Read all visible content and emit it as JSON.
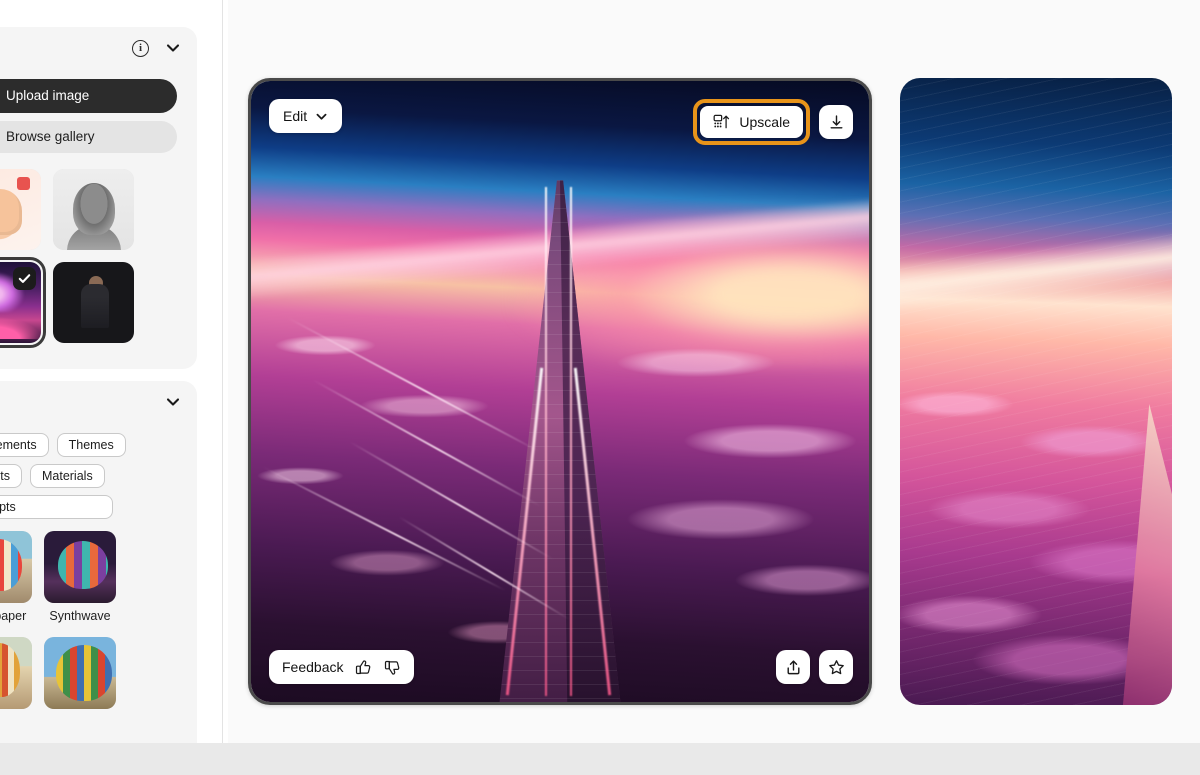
{
  "app": {
    "background_color": "#e9e9e9",
    "canvas_color": "#fafafa",
    "accent_highlight_color": "#e8941a"
  },
  "sidebar": {
    "upload_panel": {
      "info_icon": "info-circle-icon",
      "collapse_icon": "chevron-down-icon",
      "upload_button": {
        "label": "Upload image",
        "icon": "upload-cloud-icon"
      },
      "browse_button": {
        "label": "Browse gallery",
        "icon": "binoculars-icon"
      },
      "reference_thumbnails": [
        {
          "name": "thumbs-up-illustration",
          "selected": false
        },
        {
          "name": "classical-portrait-sketch",
          "selected": false
        },
        {
          "name": "synthwave-clouds",
          "selected": true
        },
        {
          "name": "person-in-dark-room",
          "selected": false
        }
      ],
      "selected_badge_icon": "check-icon"
    },
    "styles_panel": {
      "collapse_icon": "chevron-down-icon",
      "chips": [
        {
          "label": "Movements"
        },
        {
          "label": "Themes"
        },
        {
          "label": "Effects"
        },
        {
          "label": "Materials"
        },
        {
          "label": "oncepts"
        }
      ],
      "gallery": [
        {
          "caption": "ered paper",
          "art": "hot-air-balloon-paper"
        },
        {
          "caption": "Synthwave",
          "art": "hot-air-balloon-synthwave"
        },
        {
          "caption": "",
          "art": "hot-air-balloon-warm"
        },
        {
          "caption": "",
          "art": "hot-air-balloon-rainbow"
        }
      ]
    }
  },
  "main": {
    "selected_card": {
      "name": "generated-image-skyscraper",
      "edit_button": {
        "label": "Edit",
        "icon": "chevron-down-icon"
      },
      "upscale_button": {
        "label": "Upscale",
        "icon": "upscale-icon",
        "highlighted": true
      },
      "download_button": {
        "icon": "download-icon"
      },
      "feedback": {
        "label": "Feedback",
        "thumbs_up_icon": "thumbs-up-icon",
        "thumbs_down_icon": "thumbs-down-icon"
      },
      "share_button": {
        "icon": "share-icon"
      },
      "favorite_button": {
        "icon": "star-icon"
      }
    },
    "next_card": {
      "name": "generated-image-clouds"
    }
  }
}
